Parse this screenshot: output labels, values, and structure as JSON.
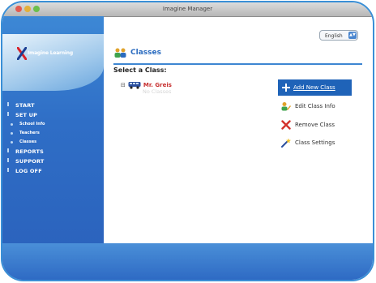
{
  "window": {
    "title": "Imagine Manager"
  },
  "language": {
    "selected": "English"
  },
  "sidebar": {
    "logo_text": "Imagine Learning",
    "nav": [
      {
        "label": "START"
      },
      {
        "label": "SET UP"
      },
      {
        "label": "School Info",
        "sub": true
      },
      {
        "label": "Teachers",
        "sub": true
      },
      {
        "label": "Classes",
        "sub": true
      },
      {
        "label": "REPORTS"
      },
      {
        "label": "SUPPORT"
      },
      {
        "label": "LOG OFF"
      }
    ]
  },
  "main": {
    "title": "Classes",
    "select_label": "Select a Class:",
    "tree": {
      "expand_symbol": "⊟",
      "teacher": "Mr. Greis",
      "empty_text": "No Classes"
    },
    "actions": {
      "add": "Add New Class",
      "edit": "Edit Class Info",
      "remove": "Remove Class",
      "settings": "Class Settings"
    }
  },
  "colors": {
    "accent": "#2a6bbf",
    "sidebar": "#2f6ec6",
    "teacher_name": "#c62c2c",
    "remove_icon": "#d3312a"
  }
}
